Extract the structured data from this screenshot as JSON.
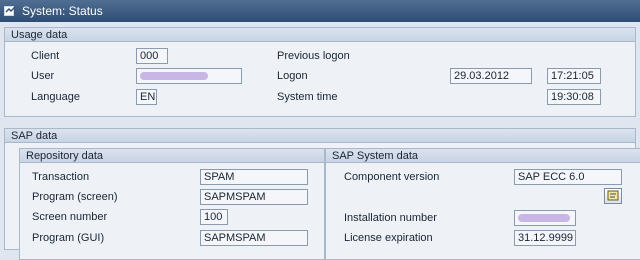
{
  "window": {
    "title": "System: Status"
  },
  "usage": {
    "title": "Usage data",
    "client_label": "Client",
    "client_value": "000",
    "user_label": "User",
    "user_value": "",
    "language_label": "Language",
    "language_value": "EN",
    "previous_logon_label": "Previous logon",
    "logon_label": "Logon",
    "logon_date": "29.03.2012",
    "logon_time": "17:21:05",
    "system_time_label": "System time",
    "system_time_value": "19:30:08"
  },
  "sap": {
    "title": "SAP data",
    "repository": {
      "title": "Repository data",
      "transaction_label": "Transaction",
      "transaction_value": "SPAM",
      "program_screen_label": "Program (screen)",
      "program_screen_value": "SAPMSPAM",
      "screen_number_label": "Screen number",
      "screen_number_value": "100",
      "program_gui_label": "Program (GUI)",
      "program_gui_value": "SAPMSPAM"
    },
    "system": {
      "title": "SAP System data",
      "component_label": "Component version",
      "component_value": "SAP ECC 6.0",
      "installation_label": "Installation number",
      "installation_value": "",
      "license_label": "License expiration",
      "license_value": "31.12.9999"
    }
  },
  "icons": [
    "status-icon",
    "details-icon"
  ],
  "colors": {
    "title_bar": "#2f4d73",
    "redaction": "#c8b6e6"
  }
}
